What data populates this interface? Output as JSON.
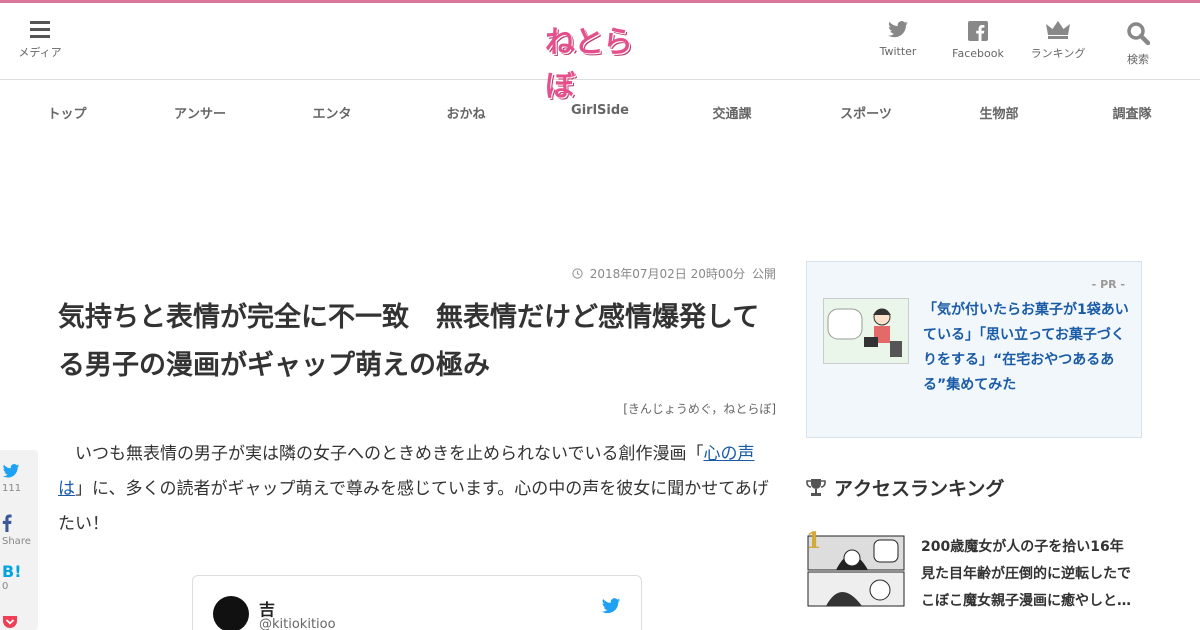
{
  "header": {
    "menu_label": "メディア",
    "logo_text": "ねとらぼ",
    "icons": [
      {
        "name": "twitter-icon",
        "label": "Twitter"
      },
      {
        "name": "facebook-icon",
        "label": "Facebook"
      },
      {
        "name": "crown-icon",
        "label": "ランキング"
      },
      {
        "name": "search-icon",
        "label": "検索"
      }
    ]
  },
  "nav": {
    "items": [
      "トップ",
      "アンサー",
      "エンタ",
      "おかね",
      "GirlSide",
      "交通課",
      "スポーツ",
      "生物部",
      "調査隊"
    ]
  },
  "article": {
    "date": "2018年07月02日 20時00分",
    "date_suffix": "公開",
    "title": "気持ちと表情が完全に不一致　無表情だけど感情爆発してる男子の漫画がギャップ萌えの極み",
    "byline": "[きんじょうめぐ，ねとらぼ]",
    "body_pre": "いつも無表情の男子が実は隣の女子へのときめきを止められないでいる創作漫画「",
    "body_link": "心の声は",
    "body_post": "」に、多くの読者がギャップ萌えで尊みを感じています。心の中の声を彼女に聞かせてあげたい！",
    "embed": {
      "name": "吉",
      "handle": "@kitiokitioo"
    }
  },
  "share": {
    "twitter_count": "111",
    "facebook_label": "Share",
    "hatena_label": "B!",
    "hatena_count": "0"
  },
  "sidebar": {
    "pr_label": "- PR -",
    "pr_text": "「気が付いたらお菓子が1袋あいている」「思い立ってお菓子づくりをする」“在宅おやつあるある”集めてみた",
    "ranking_title": "アクセスランキング",
    "ranking": [
      {
        "rank": "1",
        "text": "200歳魔女が人の子を拾い16年 見た目年齢が圧倒的に逆転したでこぼこ魔女親子漫画に癒やしと…"
      }
    ]
  },
  "colors": {
    "brand": "#e4508b",
    "accent": "#d9779a",
    "link": "#1a5ba8",
    "twitter": "#1da1f2",
    "rank_gold": "#d4a93a"
  }
}
